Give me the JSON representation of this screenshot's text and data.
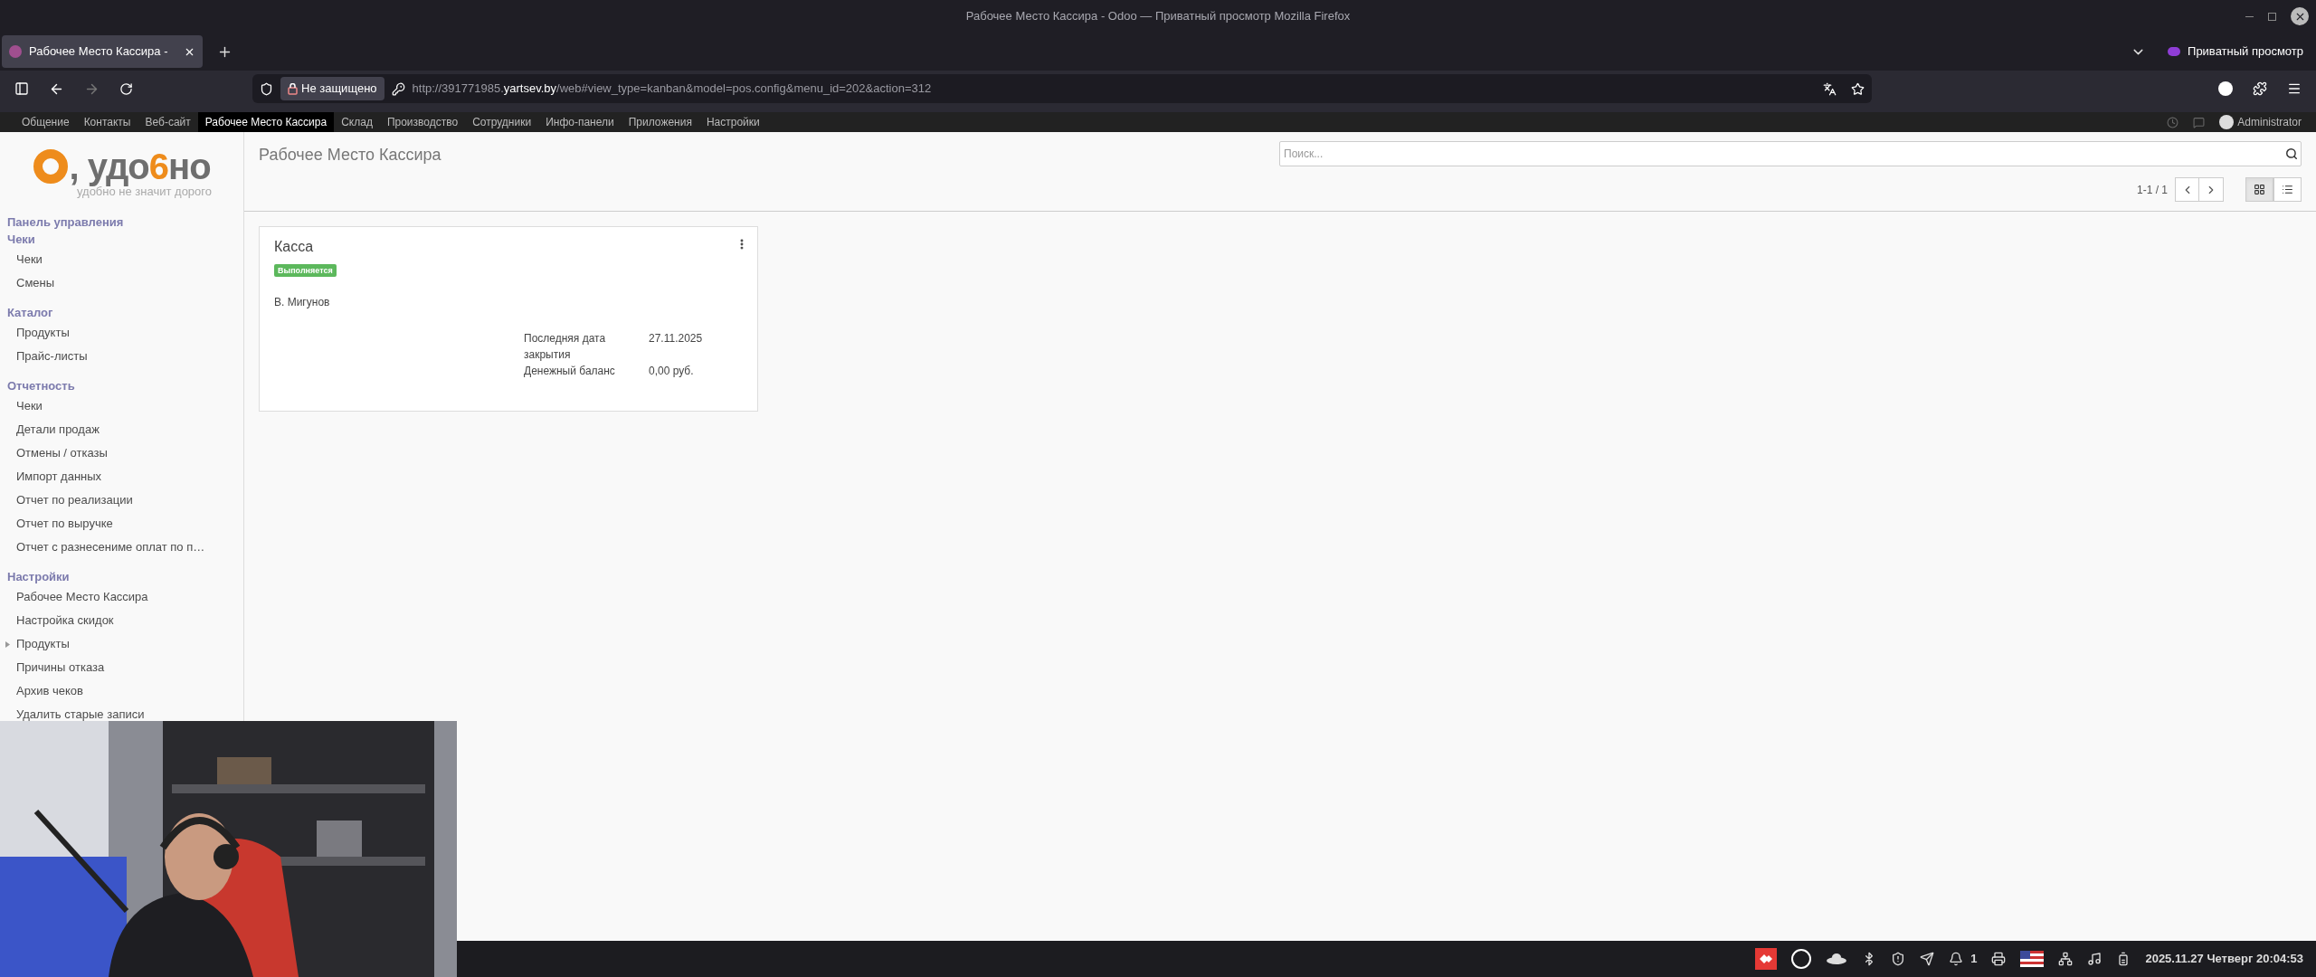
{
  "window": {
    "title": "Рабочее Место Кассира - Odoo — Приватный просмотр Mozilla Firefox"
  },
  "browser": {
    "tabs": [
      {
        "title": "Рабочее Место Кассира -",
        "selected": true
      }
    ],
    "private_label": "Приватный просмотр",
    "security_label": "Не защищено",
    "url_prefix": "http://391771985.",
    "url_domain": "yartsev.by",
    "url_path": "/web#view_type=kanban&model=pos.config&menu_id=202&action=312"
  },
  "app_menu": {
    "items": [
      {
        "label": "Общение",
        "selected": false
      },
      {
        "label": "Контакты",
        "selected": false
      },
      {
        "label": "Веб-сайт",
        "selected": false
      },
      {
        "label": "Рабочее Место Кассира",
        "selected": true
      },
      {
        "label": "Склад",
        "selected": false
      },
      {
        "label": "Производство",
        "selected": false
      },
      {
        "label": "Сотрудники",
        "selected": false
      },
      {
        "label": "Инфо-панели",
        "selected": false
      },
      {
        "label": "Приложения",
        "selected": false
      },
      {
        "label": "Настройки",
        "selected": false
      }
    ],
    "user": "Administrator"
  },
  "logo": {
    "prefix": ", удо",
    "accent": "6",
    "suffix": "но",
    "tagline": "удобно не значит дорого"
  },
  "sidebar": {
    "sections": [
      {
        "title": "Панель управления"
      },
      {
        "title": "Чеки",
        "items": [
          {
            "label": "Чеки",
            "kind": "item"
          },
          {
            "label": "Смены",
            "kind": "item"
          }
        ]
      },
      {
        "title": "Каталог",
        "items": [
          {
            "label": "Продукты",
            "kind": "item"
          },
          {
            "label": "Прайс-листы",
            "kind": "item"
          }
        ]
      },
      {
        "title": "Отчетность",
        "items": [
          {
            "label": "Чеки",
            "kind": "item"
          },
          {
            "label": "Детали продаж",
            "kind": "item"
          },
          {
            "label": "Отмены / отказы",
            "kind": "item"
          },
          {
            "label": "Импорт данных",
            "kind": "item"
          },
          {
            "label": "Отчет по реализации",
            "kind": "item"
          },
          {
            "label": "Отчет по выручке",
            "kind": "item"
          },
          {
            "label": "Отчет с разнесениме оплат по п…",
            "kind": "item"
          }
        ]
      },
      {
        "title": "Настройки",
        "items": [
          {
            "label": "Рабочее Место Кассира",
            "kind": "item"
          },
          {
            "label": "Настройка скидок",
            "kind": "item"
          },
          {
            "label": "Продукты",
            "kind": "group"
          },
          {
            "label": "Причины отказа",
            "kind": "item"
          },
          {
            "label": "Архив чеков",
            "kind": "item"
          },
          {
            "label": "Удалить старые записи",
            "kind": "item"
          }
        ]
      }
    ]
  },
  "page": {
    "title": "Рабочее Место Кассира",
    "search": {
      "placeholder": "Поиск..."
    },
    "pager": "1-1 / 1",
    "views": [
      {
        "kind": "kanban",
        "selected": true
      },
      {
        "kind": "list",
        "selected": false
      }
    ]
  },
  "cards": [
    {
      "name": "Касса",
      "status": "Выполняется",
      "user": "В. Мигунов",
      "fields": [
        {
          "label": "Последняя дата закрытия",
          "value": "27.11.2025"
        },
        {
          "label": "Денежный баланс",
          "value": "0,00 руб."
        }
      ]
    }
  ],
  "taskbar": {
    "notification_count": "1",
    "datetime": "2025.11.27 Четверг 20:04:53"
  }
}
